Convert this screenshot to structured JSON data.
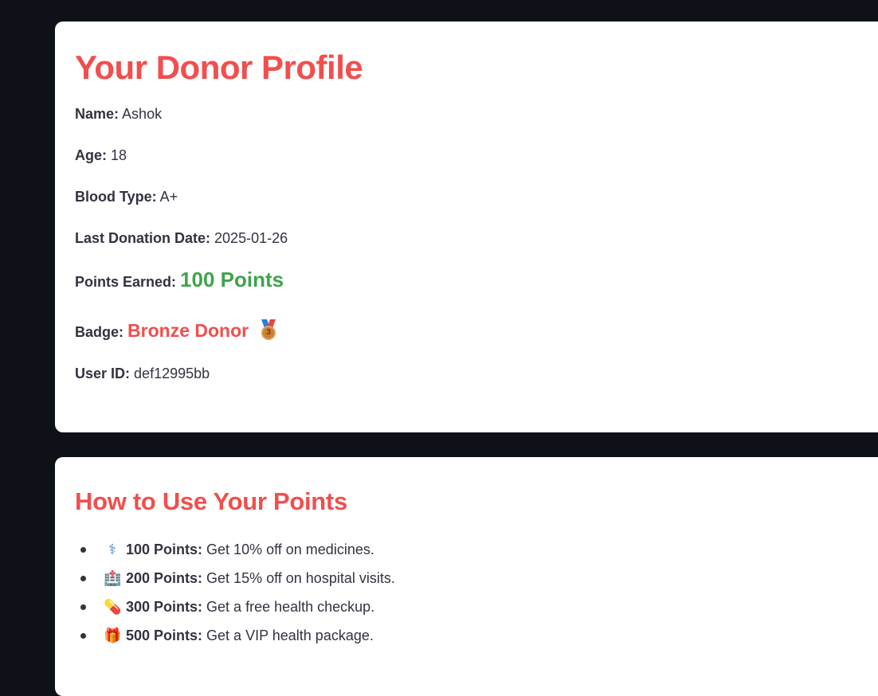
{
  "profile": {
    "title": "Your Donor Profile",
    "name_label": "Name:",
    "name_value": "Ashok",
    "age_label": "Age:",
    "age_value": "18",
    "blood_label": "Blood Type:",
    "blood_value": "A+",
    "last_donation_label": "Last Donation Date:",
    "last_donation_value": "2025-01-26",
    "points_label": "Points Earned:",
    "points_value": "100 Points",
    "badge_label": "Badge:",
    "badge_value": "Bronze Donor",
    "badge_icon": "bronze-medal-icon",
    "badge_medal_number": "3",
    "userid_label": "User ID:",
    "userid_value": "def12995bb"
  },
  "rewards": {
    "title": "How to Use Your Points",
    "items": [
      {
        "icon": "stethoscope-icon",
        "glyph": "⚕",
        "points": "100 Points:",
        "text": "Get 10% off on medicines."
      },
      {
        "icon": "hospital-icon",
        "glyph": "🏥",
        "points": "200 Points:",
        "text": "Get 15% off on hospital visits."
      },
      {
        "icon": "pill-icon",
        "glyph": "💊",
        "points": "300 Points:",
        "text": "Get a free health checkup."
      },
      {
        "icon": "gift-icon",
        "glyph": "🎁",
        "points": "500 Points:",
        "text": "Get a VIP health package."
      }
    ]
  },
  "colors": {
    "background": "#0e1117",
    "card": "#ffffff",
    "heading": "#f14e4e",
    "points": "#3fa34d",
    "text": "#31333f"
  }
}
